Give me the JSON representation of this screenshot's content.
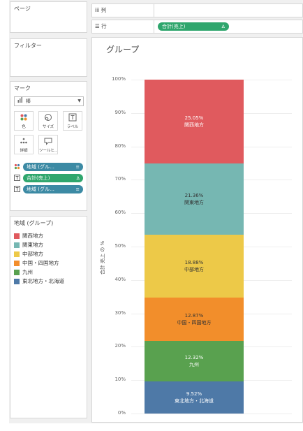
{
  "panels": {
    "pages": "ページ",
    "filters": "フィルター",
    "marks": "マーク"
  },
  "marks_card": {
    "mark_type": "棒",
    "mark_type_icon": "bar-chart-icon",
    "buttons": [
      {
        "label": "色",
        "icon": "color-icon"
      },
      {
        "label": "サイズ",
        "icon": "size-icon"
      },
      {
        "label": "ラベル",
        "icon": "label-icon"
      },
      {
        "label": "詳細",
        "icon": "detail-icon"
      },
      {
        "label": "ツールヒ…",
        "icon": "tooltip-icon"
      }
    ],
    "fields": [
      {
        "label": "地域 (グル…",
        "icon": "sort-icon"
      },
      {
        "label": "合計(売上)",
        "icon": "delta-icon"
      },
      {
        "label": "地域 (グル…",
        "icon": "sort-icon"
      }
    ]
  },
  "shelves": {
    "columns": "列",
    "rows": "行",
    "rows_pill": "合計(売上)",
    "rows_pill_icon": "Δ"
  },
  "legend": {
    "title": "地域 (グループ)",
    "items": [
      {
        "label": "関西地方",
        "color": "#e05a5e"
      },
      {
        "label": "関東地方",
        "color": "#76b7b2"
      },
      {
        "label": "中部地方",
        "color": "#edc948"
      },
      {
        "label": "中国・四国地方",
        "color": "#f28e2b"
      },
      {
        "label": "九州",
        "color": "#59a14f"
      },
      {
        "label": "東北地方・北海道",
        "color": "#4e79a7"
      }
    ]
  },
  "chart_data": {
    "type": "bar",
    "title": "グループ",
    "xlabel": "",
    "ylabel": "合計 売上 の %",
    "ylim": [
      0,
      100
    ],
    "y_ticks": [
      "0%",
      "10%",
      "20%",
      "30%",
      "40%",
      "50%",
      "60%",
      "70%",
      "80%",
      "90%",
      "100%"
    ],
    "stacked": true,
    "series": [
      {
        "name": "東北地方・北海道",
        "value": 9.52,
        "label": "9.52%",
        "color": "#4e79a7",
        "text_color": "#ffffff"
      },
      {
        "name": "九州",
        "value": 12.32,
        "label": "12.32%",
        "color": "#59a14f",
        "text_color": "#ffffff"
      },
      {
        "name": "中国・四国地方",
        "value": 12.87,
        "label": "12.87%",
        "color": "#f28e2b",
        "text_color": "#333333"
      },
      {
        "name": "中部地方",
        "value": 18.88,
        "label": "18.88%",
        "color": "#edc948",
        "text_color": "#333333"
      },
      {
        "name": "関東地方",
        "value": 21.36,
        "label": "21.36%",
        "color": "#76b7b2",
        "text_color": "#333333"
      },
      {
        "name": "関西地方",
        "value": 25.05,
        "label": "25.05%",
        "color": "#e05a5e",
        "text_color": "#ffffff"
      }
    ]
  }
}
